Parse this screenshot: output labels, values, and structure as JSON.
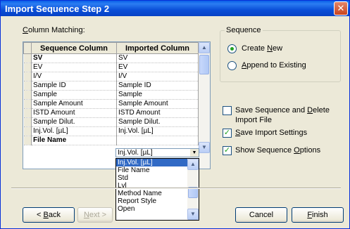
{
  "window": {
    "title": "Import Sequence Step 2",
    "close_glyph": "✕"
  },
  "column_matching": {
    "label_mnemonic": "C",
    "label_rest": "olumn Matching:",
    "headers": {
      "sequence": "Sequence Column",
      "imported": "Imported Column"
    },
    "rows": [
      {
        "seq": "SV",
        "imp": "SV",
        "bold": true
      },
      {
        "seq": "EV",
        "imp": "EV"
      },
      {
        "seq": "I/V",
        "imp": "I/V"
      },
      {
        "seq": "Sample ID",
        "imp": "Sample ID"
      },
      {
        "seq": "Sample",
        "imp": "Sample"
      },
      {
        "seq": "Sample Amount",
        "imp": "Sample Amount"
      },
      {
        "seq": "ISTD Amount",
        "imp": "ISTD Amount"
      },
      {
        "seq": "Sample Dilut.",
        "imp": "Sample Dilut."
      },
      {
        "seq": "Inj.Vol. [µL]",
        "imp": "Inj.Vol. [µL]"
      },
      {
        "seq": "File Name",
        "imp": "",
        "bold": true
      }
    ],
    "combo_value": "Inj.Vol. [µL]",
    "dropdown_options": [
      "Inj.Vol. [µL]",
      "File Name",
      "Std",
      "Lvl",
      "Method Name",
      "Report Style",
      "Open"
    ],
    "dropdown_selected": "Inj.Vol. [µL]"
  },
  "sequence_group": {
    "legend": "Sequence",
    "create_new": {
      "pre": "Create ",
      "mnemonic": "N",
      "post": "ew",
      "checked": true
    },
    "append": {
      "pre": "",
      "mnemonic": "A",
      "post": "ppend to Existing",
      "checked": false
    }
  },
  "options": {
    "save_delete": {
      "line1_pre": "Save Sequence and ",
      "line1_mnemonic": "D",
      "line1_post": "elete",
      "line2": "Import File",
      "checked": false
    },
    "save_import": {
      "pre": "",
      "mnemonic": "S",
      "post": "ave Import Settings",
      "checked": true
    },
    "show_options": {
      "pre": "Show Sequence ",
      "mnemonic": "O",
      "post": "ptions",
      "checked": true
    }
  },
  "buttons": {
    "back": {
      "pre": "< ",
      "mnemonic": "B",
      "post": "ack"
    },
    "next": {
      "pre": "",
      "mnemonic": "N",
      "post": "ext >"
    },
    "cancel": "Cancel",
    "finish": {
      "mnemonic": "F",
      "post": "inish"
    }
  }
}
